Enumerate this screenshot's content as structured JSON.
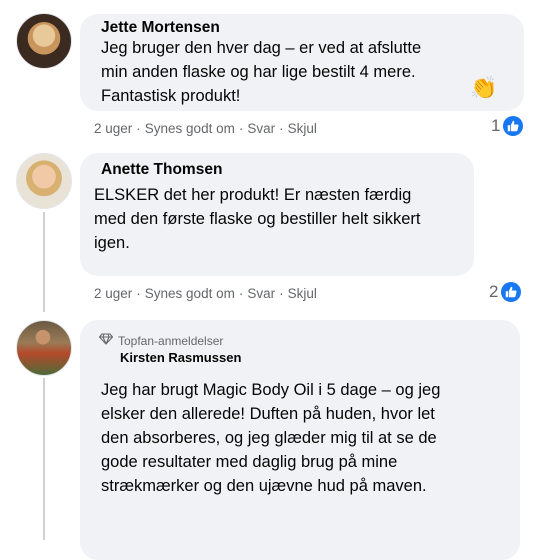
{
  "comments": [
    {
      "author": "Jette Mortensen",
      "lines": [
        "Jeg bruger den hver dag – er ved at afslutte",
        "min anden flaske og har lige bestilt 4 mere.",
        "Fantastisk produkt!"
      ],
      "emoji": "👏",
      "time": "2 uger",
      "like_label": "Synes godt om",
      "reply_label": "Svar",
      "hide_label": "Skjul",
      "reaction_count": "1"
    },
    {
      "author": "Anette Thomsen",
      "lines": [
        "ELSKER det her produkt! Er næsten færdig",
        "med den første flaske og bestiller helt sikkert",
        "igen."
      ],
      "time": "2 uger",
      "like_label": "Synes godt om",
      "reply_label": "Svar",
      "hide_label": "Skjul",
      "reaction_count": "2"
    },
    {
      "badge": "Topfan-anmeldelser",
      "author": "Kirsten Rasmussen",
      "lines": [
        "Jeg har brugt Magic Body Oil i 5 dage – og jeg",
        "elsker den allerede! Duften på huden, hvor let",
        "den absorberes, og jeg glæder mig til at se de",
        "gode resultater med daglig brug på mine",
        "strækmærker og den ujævne hud på maven."
      ]
    }
  ],
  "colors": {
    "bubble": "#f0f2f5",
    "meta": "#65676b",
    "like": "#1877f2"
  },
  "icons": {
    "reaction": "thumbs-up-icon",
    "badge": "diamond-icon"
  }
}
